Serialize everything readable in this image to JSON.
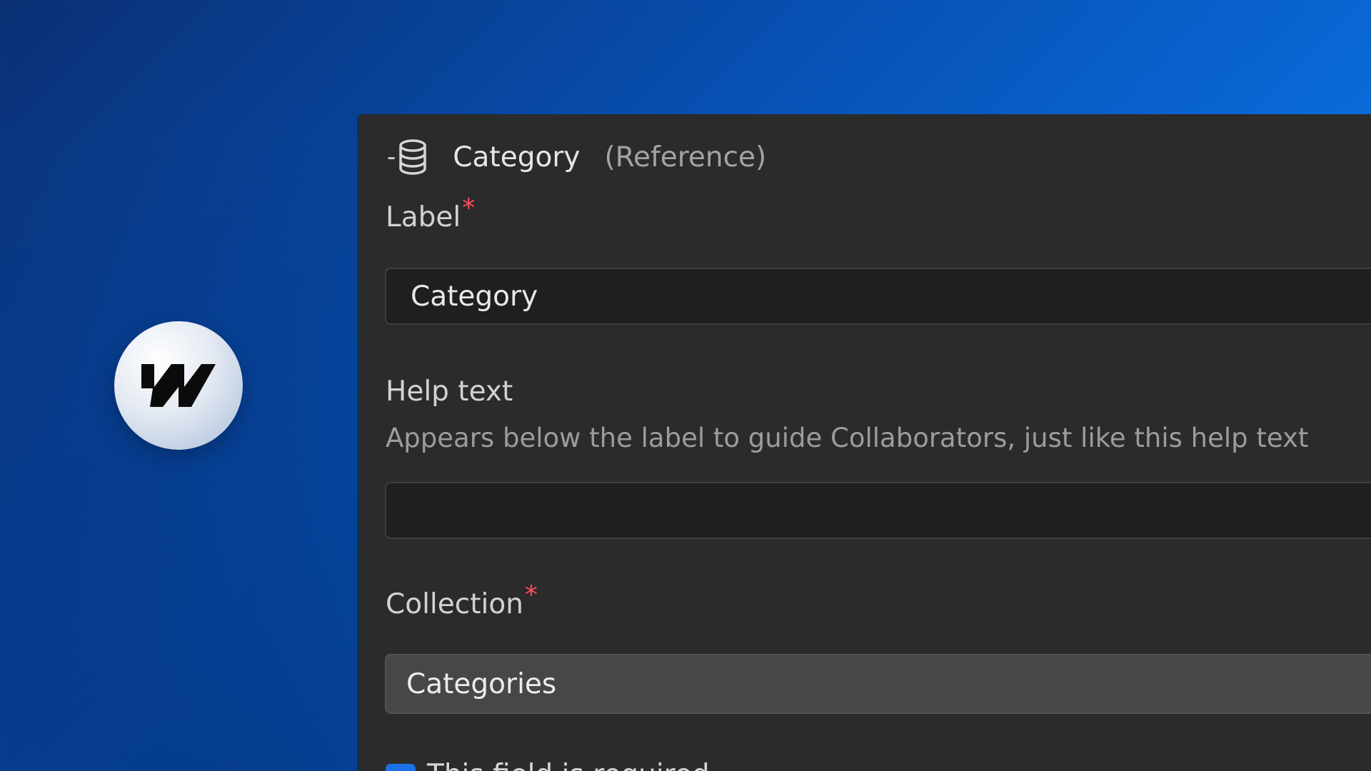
{
  "logo": {
    "icon": "webflow-logo-icon"
  },
  "panel": {
    "header": {
      "icon": "database-icon",
      "prefix": "-",
      "title": "Category",
      "subtitle": "(Reference)"
    },
    "label_field": {
      "label": "Label",
      "required_mark": "*",
      "value": "Category"
    },
    "help_field": {
      "label": "Help text",
      "description": "Appears below the label to guide Collaborators, just like this help text",
      "value": ""
    },
    "collection_field": {
      "label": "Collection",
      "required_mark": "*",
      "value": "Categories"
    },
    "required_checkbox": {
      "label": "This field is required",
      "checked": true
    }
  },
  "colors": {
    "accent": "#1b72e6",
    "required": "#ff4d5e",
    "panel_bg": "#2b2b2b"
  }
}
